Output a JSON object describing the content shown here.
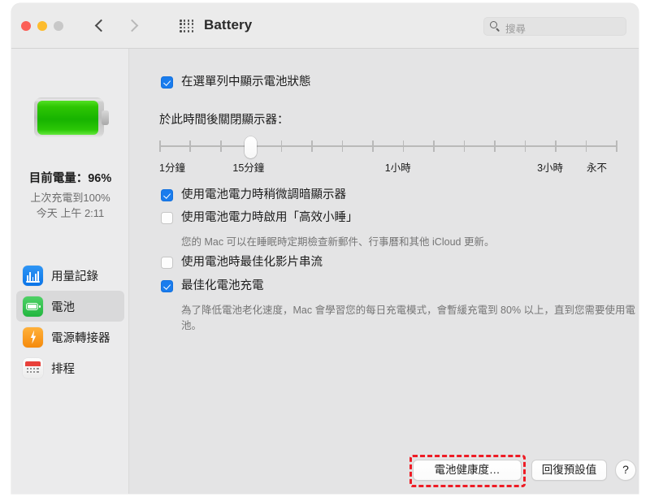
{
  "window": {
    "title": "Battery",
    "traffic_lights": [
      "close",
      "minimize",
      "zoom"
    ],
    "nav_back": "back-chevron",
    "nav_forward": "forward-chevron",
    "grid_button": "show-all-icon"
  },
  "search": {
    "placeholder": "搜尋",
    "icon": "search-icon"
  },
  "sidebar": {
    "battery_icon": "battery-full-green-icon",
    "charge_level": "目前電量：96%",
    "last_charge": "上次充電到100%",
    "last_charge_time": "今天 上午 2:11",
    "items": [
      {
        "label": "用量記錄",
        "icon": "usage-history-icon",
        "selected": false
      },
      {
        "label": "電池",
        "icon": "battery-icon",
        "selected": true
      },
      {
        "label": "電源轉接器",
        "icon": "power-adapter-icon",
        "selected": false
      },
      {
        "label": "排程",
        "icon": "schedule-calendar-icon",
        "selected": false
      }
    ]
  },
  "main": {
    "show_in_menubar": {
      "label": "在選單列中顯示電池狀態",
      "checked": true
    },
    "display_off_label": "於此時間後關閉顯示器：",
    "slider": {
      "tick_count": 16,
      "value_index": 3,
      "labels": [
        {
          "text": "1分鐘",
          "pos": 0
        },
        {
          "text": "15分鐘",
          "pos": 3
        },
        {
          "text": "1小時",
          "pos": 8
        },
        {
          "text": "3小時",
          "pos": 13
        },
        {
          "text": "永不",
          "pos": 15
        }
      ]
    },
    "options": [
      {
        "label": "使用電池電力時稍微調暗顯示器",
        "checked": true,
        "desc": ""
      },
      {
        "label": "使用電池電力時啟用「高效小睡」",
        "checked": false,
        "desc": "您的 Mac 可以在睡眠時定期檢查新郵件、行事曆和其他 iCloud 更新。"
      },
      {
        "label": "使用電池時最佳化影片串流",
        "checked": false,
        "desc": ""
      },
      {
        "label": "最佳化電池充電",
        "checked": true,
        "desc": "為了降低電池老化速度，Mac 會學習您的每日充電模式，會暫緩充電到 80% 以上，直到您需要使用電池。"
      }
    ],
    "buttons": {
      "battery_health": "電池健康度…",
      "restore_defaults": "回復預設值",
      "help": "?"
    },
    "annotation_color": "#ee1c25"
  }
}
